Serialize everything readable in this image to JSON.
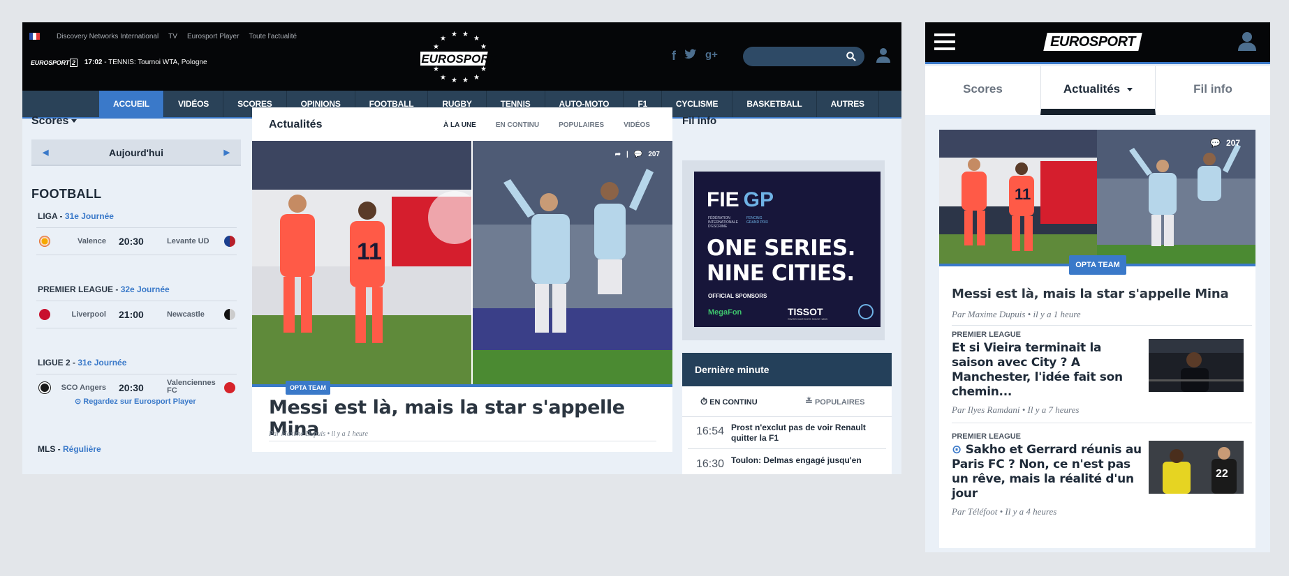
{
  "desktop": {
    "toplinks": [
      "Discovery Networks International",
      "TV",
      "Eurosport Player",
      "Toute l'actualité"
    ],
    "channel": {
      "logo_text": "EUROSPORT",
      "logo_num": "2",
      "time": "17:02",
      "program": "- TENNIS: Tournoi WTA, Pologne"
    },
    "logo_text": "EUROSPORT",
    "nav": [
      "ACCUEIL",
      "VIDÉOS",
      "SCORES",
      "OPINIONS",
      "FOOTBALL",
      "RUGBY",
      "TENNIS",
      "AUTO-MOTO",
      "F1",
      "CYCLISME",
      "BASKETBALL",
      "AUTRES"
    ],
    "scores": {
      "title": "Scores",
      "date": "Aujourd'hui",
      "sport": "FOOTBALL",
      "leagues": [
        {
          "name": "LIGA - ",
          "day": "31e Journée",
          "home": "Valence",
          "time": "20:30",
          "away": "Levante UD"
        },
        {
          "name": "PREMIER LEAGUE - ",
          "day": "32e Journée",
          "home": "Liverpool",
          "time": "21:00",
          "away": "Newcastle"
        },
        {
          "name": "LIGUE 2 - ",
          "day": "31e Journée",
          "home": "SCO Angers",
          "time": "20:30",
          "away": "Valenciennes FC"
        }
      ],
      "watch": "Regardez sur Eurosport Player",
      "mls": {
        "name": "MLS - ",
        "day": "Régulière"
      }
    },
    "news": {
      "title": "Actualités",
      "tabs": [
        "À LA UNE",
        "EN CONTINU",
        "POPULAIRES",
        "VIDÉOS"
      ],
      "comments": "207",
      "tag": "OPTA TEAM",
      "headline": "Messi est là, mais la star s'appelle Mina",
      "byline": "Par Maxime Dupuis • il y a 1 heure"
    },
    "filinfo": {
      "title": "Fil info",
      "ad": {
        "brand": "FIE",
        "gp": "GP",
        "fed": "FÉDÉRATION INTERNATIONALE D'ESCRIME",
        "fed2": "FENCING GRAND PRIX",
        "line1": "ONE SERIES.",
        "line2": "NINE CITIES.",
        "sponsors": "OFFICIAL SPONSORS",
        "s1": "MegaFon",
        "s2": "TISSOT",
        "s2sub": "SWISS WATCHES SINCE 1853"
      },
      "derniere": "Dernière minute",
      "tabs": [
        "EN CONTINU",
        "POPULAIRES"
      ],
      "items": [
        {
          "time": "16:54",
          "text": "Prost n'exclut pas de voir Renault quitter la F1"
        },
        {
          "time": "16:30",
          "text": "Toulon: Delmas engagé jusqu'en"
        }
      ]
    }
  },
  "mobile": {
    "logo_text": "EUROSPORT",
    "tabs": [
      "Scores",
      "Actualités",
      "Fil info"
    ],
    "comments": "207",
    "tag": "OPTA TEAM",
    "headline": "Messi est là, mais la star s'appelle Mina",
    "byline": "Par Maxime Dupuis • il y a 1 heure",
    "articles": [
      {
        "league": "PREMIER LEAGUE",
        "title": "Et si Vieira terminait la saison avec City ? A Manchester, l'idée fait son chemin...",
        "byline": "Par Ilyes Ramdani • Il y a 7 heures"
      },
      {
        "league": "PREMIER LEAGUE",
        "title": "Sakho et Gerrard réunis au Paris FC ? Non, ce n'est pas un rêve, mais la réalité d'un jour",
        "byline": "Par Téléfoot • Il y a 4 heures"
      }
    ]
  },
  "colors": {
    "accent": "#3a79c9",
    "navbar": "#2a4258",
    "topbar": "#050608",
    "ad_bg": "#17163a"
  }
}
